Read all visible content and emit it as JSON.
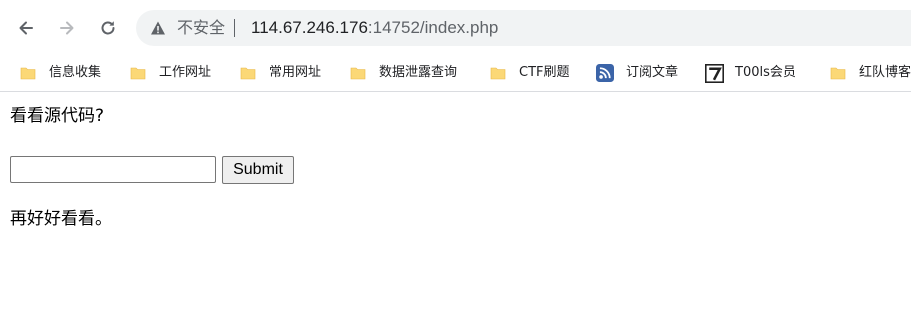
{
  "browser": {
    "back_icon": "arrow-left-icon",
    "forward_icon": "arrow-right-icon",
    "reload_icon": "reload-icon",
    "security_icon": "warning-triangle-icon",
    "security_label": "不安全",
    "url_host": "114.67.246.176",
    "url_rest": ":14752/index.php"
  },
  "bookmarks": [
    {
      "label": "信息收集",
      "icon": "folder-icon"
    },
    {
      "label": "工作网址",
      "icon": "folder-icon"
    },
    {
      "label": "常用网址",
      "icon": "folder-icon"
    },
    {
      "label": "数据泄露查询",
      "icon": "folder-icon"
    },
    {
      "label": "CTF刷题",
      "icon": "folder-icon"
    },
    {
      "label": "订阅文章",
      "icon": "rss-icon"
    },
    {
      "label": "T00ls会员",
      "icon": "t00ls-icon"
    },
    {
      "label": "红队博客",
      "icon": "folder-icon"
    }
  ],
  "page": {
    "prompt": "看看源代码?",
    "input_value": "",
    "submit_label": "Submit",
    "message": "再好好看看。"
  },
  "colors": {
    "folder": "#fbd877",
    "omnibox": "#f1f3f4",
    "icon_gray": "#5f6368",
    "rss_blue": "#3b64a8"
  }
}
